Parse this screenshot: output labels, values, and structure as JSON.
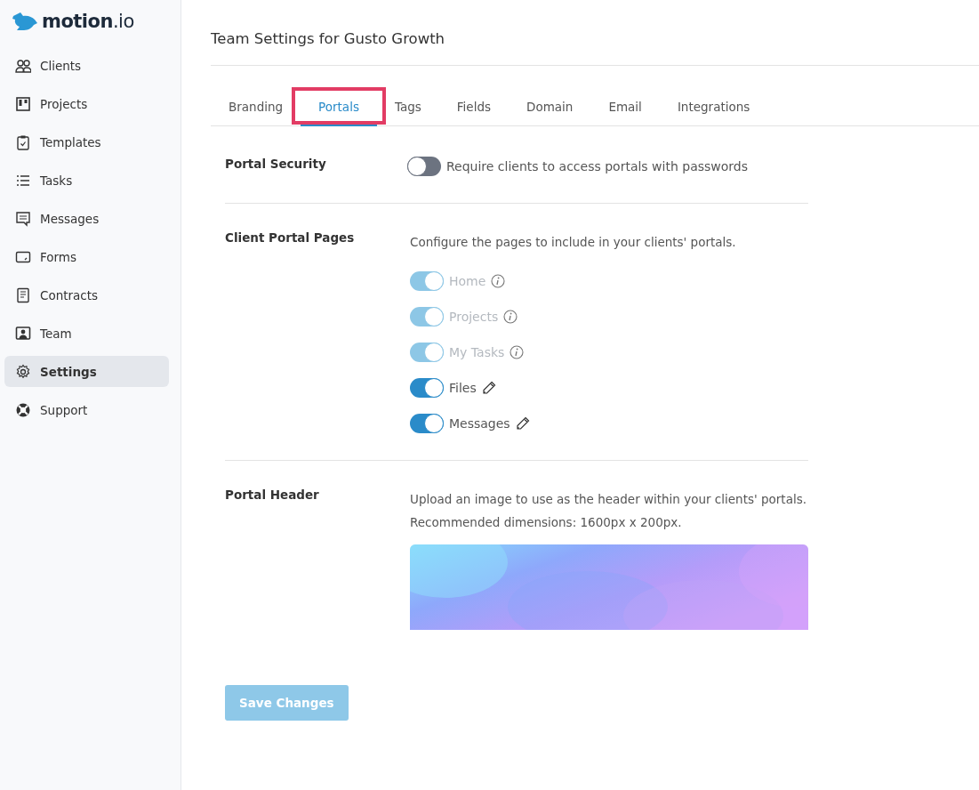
{
  "logo": {
    "text": "motion",
    "suffix": ".io"
  },
  "sidebar": {
    "items": [
      {
        "label": "Clients",
        "selected": false
      },
      {
        "label": "Projects",
        "selected": false
      },
      {
        "label": "Templates",
        "selected": false
      },
      {
        "label": "Tasks",
        "selected": false
      },
      {
        "label": "Messages",
        "selected": false
      },
      {
        "label": "Forms",
        "selected": false
      },
      {
        "label": "Contracts",
        "selected": false
      },
      {
        "label": "Team",
        "selected": false
      },
      {
        "label": "Settings",
        "selected": true
      },
      {
        "label": "Support",
        "selected": false
      }
    ]
  },
  "page_title": "Team Settings for Gusto Growth",
  "tabs": [
    {
      "label": "Branding",
      "selected": false,
      "highlighted": false
    },
    {
      "label": "Portals",
      "selected": true,
      "highlighted": true
    },
    {
      "label": "Tags",
      "selected": false,
      "highlighted": false
    },
    {
      "label": "Fields",
      "selected": false,
      "highlighted": false
    },
    {
      "label": "Domain",
      "selected": false,
      "highlighted": false
    },
    {
      "label": "Email",
      "selected": false,
      "highlighted": false
    },
    {
      "label": "Integrations",
      "selected": false,
      "highlighted": false
    }
  ],
  "portal_security": {
    "label": "Portal Security",
    "toggle": {
      "label": "Require clients to access portals with passwords",
      "on": false
    }
  },
  "client_portal_pages": {
    "label": "Client Portal Pages",
    "description": "Configure the pages to include in your clients' portals.",
    "pages": [
      {
        "label": "Home",
        "on": true,
        "disabled": true,
        "kind": "info"
      },
      {
        "label": "Projects",
        "on": true,
        "disabled": true,
        "kind": "info"
      },
      {
        "label": "My Tasks",
        "on": true,
        "disabled": true,
        "kind": "info"
      },
      {
        "label": "Files",
        "on": true,
        "disabled": false,
        "kind": "edit"
      },
      {
        "label": "Messages",
        "on": true,
        "disabled": false,
        "kind": "edit"
      }
    ]
  },
  "portal_header": {
    "label": "Portal Header",
    "description": "Upload an image to use as the header within your clients' portals. Recommended dimensions: 1600px x 200px."
  },
  "save_button": {
    "label": "Save Changes",
    "disabled": true
  }
}
